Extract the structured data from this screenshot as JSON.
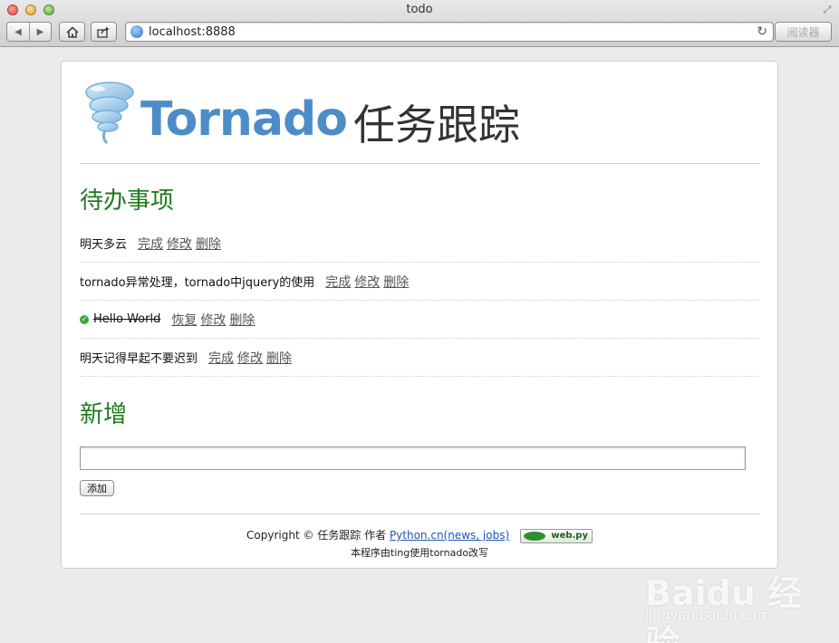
{
  "window": {
    "title": "todo"
  },
  "toolbar": {
    "back_icon": "◀",
    "forward_icon": "▶",
    "home_icon": "home-icon",
    "share_icon": "share-icon",
    "reader_label": "阅读器"
  },
  "address_bar": {
    "url": "localhost:8888"
  },
  "header": {
    "logo_word": "Tornado",
    "subtitle": "任务跟踪"
  },
  "todo": {
    "title": "待办事项",
    "items": [
      {
        "text": "明天多云",
        "done": false,
        "actions": [
          "完成",
          "修改",
          "删除"
        ]
      },
      {
        "text": "tornado异常处理，tornado中jquery的使用",
        "done": false,
        "actions": [
          "完成",
          "修改",
          "删除"
        ]
      },
      {
        "text": "Hello World",
        "done": true,
        "actions": [
          "恢复",
          "修改",
          "删除"
        ]
      },
      {
        "text": "明天记得早起不要迟到",
        "done": false,
        "actions": [
          "完成",
          "修改",
          "删除"
        ]
      }
    ]
  },
  "new_task": {
    "title": "新增",
    "input_value": "",
    "add_label": "添加"
  },
  "footer": {
    "copyright_prefix": "Copyright © 任务跟踪 作者",
    "link_text": "Python.cn(news, jobs)",
    "badge_text": "web.py",
    "line2": "本程序由ting使用tornado改写"
  },
  "watermark": {
    "brand": "Baidu 经验",
    "site": "jingyan.baidu.com"
  },
  "colors": {
    "section_green": "#1f7a1f",
    "logo_blue": "#4c8dc8",
    "link_blue": "#2255bb"
  }
}
